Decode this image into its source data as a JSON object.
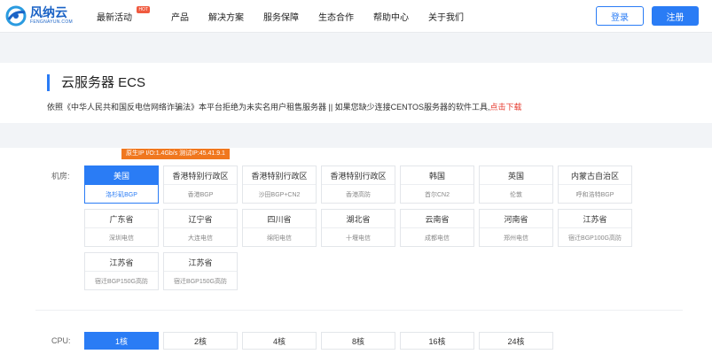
{
  "header": {
    "logo_cn": "风纳云",
    "logo_en": "FENGNAYUN.COM",
    "nav": [
      {
        "label": "最新活动",
        "badge": "HOT"
      },
      {
        "label": "产品"
      },
      {
        "label": "解决方案"
      },
      {
        "label": "服务保障"
      },
      {
        "label": "生态合作"
      },
      {
        "label": "帮助中心"
      },
      {
        "label": "关于我们"
      }
    ],
    "login_label": "登录",
    "register_label": "注册"
  },
  "banner": {
    "title": "云服务器 ECS",
    "notice": "依照《中华人民共和国反电信网络诈骗法》本平台拒绝为未实名用户租售服务器 || 如果您缺少连接CENTOS服务器的软件工具,",
    "notice_link": "点击下载"
  },
  "config": {
    "tip": "原生IP I/O:1.4Gb/s 测试IP:45.41.9.1",
    "room_label": "机房:",
    "rooms": [
      {
        "region": "美国",
        "line": "洛杉矶BGP",
        "selected": true
      },
      {
        "region": "香港特别行政区",
        "line": "香港BGP"
      },
      {
        "region": "香港特别行政区",
        "line": "沙田BGP+CN2"
      },
      {
        "region": "香港特别行政区",
        "line": "香港高防"
      },
      {
        "region": "韩国",
        "line": "首尔CN2"
      },
      {
        "region": "英国",
        "line": "伦敦"
      },
      {
        "region": "内蒙古自治区",
        "line": "呼和浩特BGP"
      },
      {
        "region": "广东省",
        "line": "深圳电信"
      },
      {
        "region": "辽宁省",
        "line": "大连电信"
      },
      {
        "region": "四川省",
        "line": "绵阳电信"
      },
      {
        "region": "湖北省",
        "line": "十堰电信"
      },
      {
        "region": "云南省",
        "line": "成都电信"
      },
      {
        "region": "河南省",
        "line": "郑州电信"
      },
      {
        "region": "江苏省",
        "line": "宿迁BGP100G高防"
      },
      {
        "region": "江苏省",
        "line": "宿迁BGP150G高防"
      },
      {
        "region": "江苏省",
        "line": "宿迁BGP150G高防"
      }
    ],
    "cpu_label": "CPU:",
    "cpu_options": [
      {
        "label": "1核",
        "selected": true
      },
      {
        "label": "2核"
      },
      {
        "label": "4核"
      },
      {
        "label": "8核"
      },
      {
        "label": "16核"
      },
      {
        "label": "24核"
      }
    ]
  },
  "colors": {
    "brand": "#2a7cf5",
    "hot": "#f05a3f",
    "tip": "#f0771e",
    "link": "#e5372b"
  },
  "icons": {
    "logo": "cloud-logo-icon"
  }
}
